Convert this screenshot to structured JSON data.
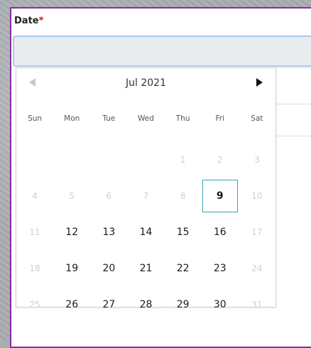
{
  "field": {
    "label": "Date",
    "required_mark": "*"
  },
  "calendar": {
    "month_label": "Jul 2021",
    "weekdays": [
      "Sun",
      "Mon",
      "Tue",
      "Wed",
      "Thu",
      "Fri",
      "Sat"
    ],
    "days": [
      {
        "d": "",
        "m": true
      },
      {
        "d": "",
        "m": true
      },
      {
        "d": "",
        "m": true
      },
      {
        "d": "",
        "m": true
      },
      {
        "d": "1",
        "m": true
      },
      {
        "d": "2",
        "m": true
      },
      {
        "d": "3",
        "m": true
      },
      {
        "d": "4",
        "m": true
      },
      {
        "d": "5",
        "m": true
      },
      {
        "d": "6",
        "m": true
      },
      {
        "d": "7",
        "m": true
      },
      {
        "d": "8",
        "m": true
      },
      {
        "d": "9",
        "m": false,
        "sel": true
      },
      {
        "d": "10",
        "m": true
      },
      {
        "d": "11",
        "m": true
      },
      {
        "d": "12",
        "m": false
      },
      {
        "d": "13",
        "m": false
      },
      {
        "d": "14",
        "m": false
      },
      {
        "d": "15",
        "m": false
      },
      {
        "d": "16",
        "m": false
      },
      {
        "d": "17",
        "m": true
      },
      {
        "d": "18",
        "m": true
      },
      {
        "d": "19",
        "m": false
      },
      {
        "d": "20",
        "m": false
      },
      {
        "d": "21",
        "m": false
      },
      {
        "d": "22",
        "m": false
      },
      {
        "d": "23",
        "m": false
      },
      {
        "d": "24",
        "m": true
      },
      {
        "d": "25",
        "m": true
      },
      {
        "d": "26",
        "m": false
      },
      {
        "d": "27",
        "m": false
      },
      {
        "d": "28",
        "m": false
      },
      {
        "d": "29",
        "m": false
      },
      {
        "d": "30",
        "m": false
      },
      {
        "d": "31",
        "m": true
      }
    ]
  },
  "icons": {
    "prev": "chevron-left-icon",
    "next": "chevron-right-icon"
  },
  "colors": {
    "border_accent": "#8a2aa6",
    "selected_outline": "#3aa6b5",
    "required": "#dd1111"
  }
}
